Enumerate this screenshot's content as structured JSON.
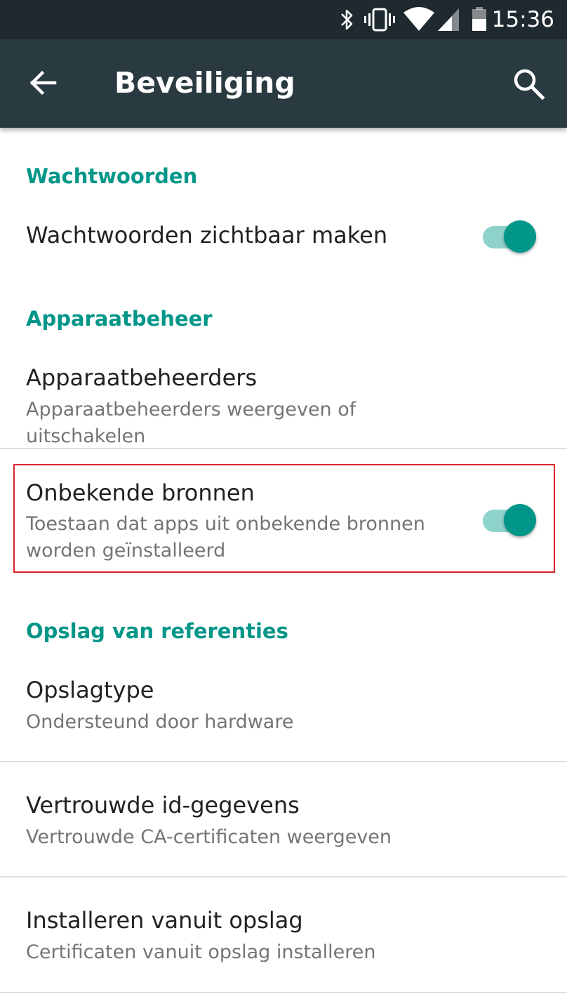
{
  "status_bar": {
    "time": "15:36",
    "icons": [
      "bluetooth-icon",
      "vibrate-icon",
      "wifi-icon",
      "cell-signal-icon",
      "battery-icon"
    ]
  },
  "toolbar": {
    "title": "Beveiliging",
    "back_icon": "arrow-left-icon",
    "search_icon": "search-icon"
  },
  "sections": {
    "passwords": {
      "header": "Wachtwoorden",
      "show_passwords": {
        "title": "Wachtwoorden zichtbaar maken",
        "enabled": true
      }
    },
    "device_admin": {
      "header": "Apparaatbeheer",
      "device_admins": {
        "title": "Apparaatbeheerders",
        "summary": "Apparaatbeheerders weergeven of uitschakelen"
      },
      "unknown_sources": {
        "title": "Onbekende bronnen",
        "summary": "Toestaan dat apps uit onbekende bronnen worden geïnstalleerd",
        "enabled": true
      }
    },
    "credential_storage": {
      "header": "Opslag van referenties",
      "storage_type": {
        "title": "Opslagtype",
        "summary": "Ondersteund door hardware"
      },
      "trusted_credentials": {
        "title": "Vertrouwde id-gegevens",
        "summary": "Vertrouwde CA-certificaten weergeven"
      },
      "install_from_storage": {
        "title": "Installeren vanuit opslag",
        "summary": "Certificaten vanuit opslag installeren"
      }
    }
  },
  "colors": {
    "accent": "#009688",
    "toolbar": "#2a3a41",
    "status_bar": "#1f2a30",
    "highlight": "#d9262e"
  }
}
